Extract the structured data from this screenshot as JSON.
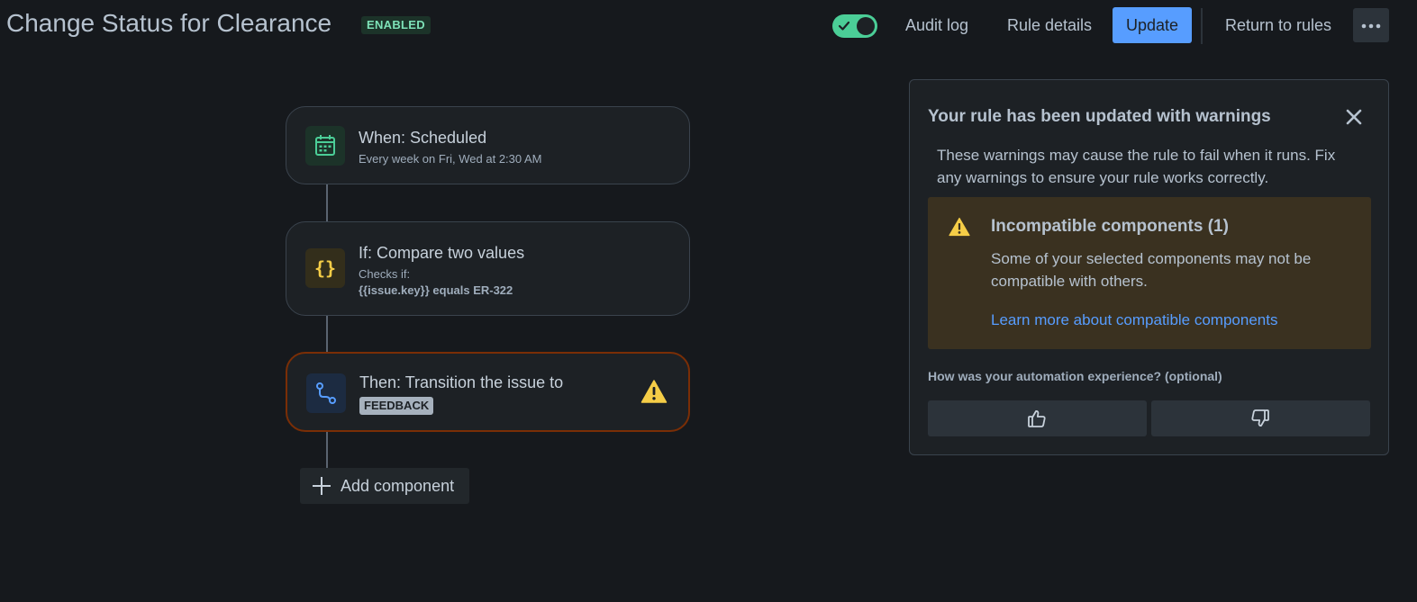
{
  "header": {
    "title": "Change Status for Clearance",
    "status_badge": "ENABLED",
    "toggle_enabled": true,
    "audit_log_label": "Audit log",
    "rule_details_label": "Rule details",
    "update_label": "Update",
    "return_label": "Return to rules",
    "more_icon": "more-horizontal-icon"
  },
  "flow": {
    "trigger": {
      "title": "When: Scheduled",
      "subtitle": "Every week on Fri, Wed at 2:30 AM",
      "icon": "calendar-icon"
    },
    "condition": {
      "title": "If: Compare two values",
      "subtitle": "Checks if:",
      "detail": "{{issue.key}} equals ER-322",
      "icon": "braces-icon"
    },
    "action": {
      "title": "Then: Transition the issue to",
      "status": "FEEDBACK",
      "icon": "transition-icon",
      "warning_icon": "warning-icon"
    },
    "add_component_label": "Add component"
  },
  "panel": {
    "title": "Your rule has been updated with warnings",
    "description": "These warnings may cause the rule to fail when it runs. Fix any warnings to ensure your rule works correctly.",
    "warning": {
      "title": "Incompatible components (1)",
      "description": "Some of your selected components may not be compatible with others.",
      "link": "Learn more about compatible components"
    },
    "feedback_label": "How was your automation experience? (optional)",
    "thumbs_up_icon": "thumbs-up-icon",
    "thumbs_down_icon": "thumbs-down-icon"
  },
  "colors": {
    "background": "#16191d",
    "accent": "#579dff",
    "enabled": "#4bce97",
    "warning": "#f5cd47",
    "warning_border": "#7a2e06"
  }
}
